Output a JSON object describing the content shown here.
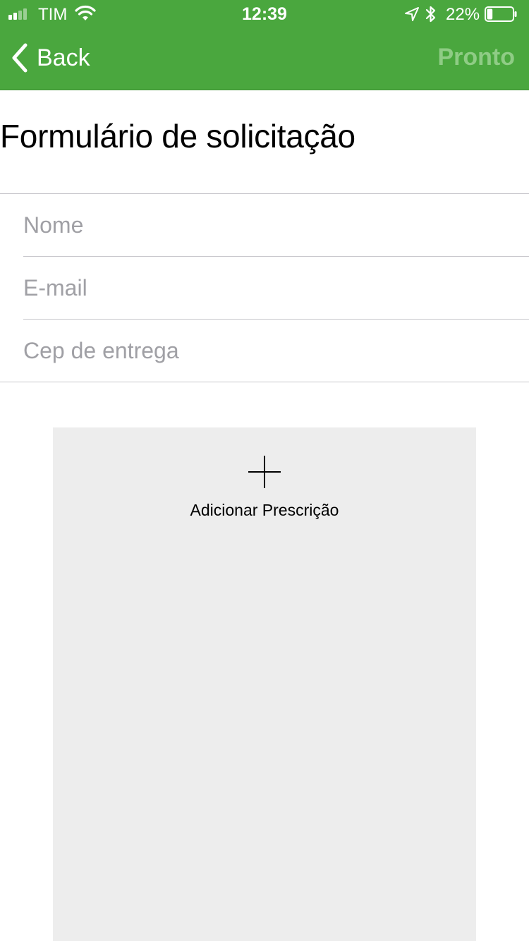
{
  "status_bar": {
    "carrier": "TIM",
    "time": "12:39",
    "battery_percent": "22%",
    "battery_level": 0.22,
    "icons": [
      "signal-icon",
      "wifi-icon",
      "location-arrow-icon",
      "bluetooth-icon",
      "battery-icon"
    ]
  },
  "nav": {
    "back_label": "Back",
    "done_label": "Pronto"
  },
  "page": {
    "title": "Formulário de solicitação"
  },
  "form": {
    "name": {
      "placeholder": "Nome",
      "value": ""
    },
    "email": {
      "placeholder": "E-mail",
      "value": ""
    },
    "zip": {
      "placeholder": "Cep de entrega",
      "value": ""
    }
  },
  "prescription": {
    "add_label": "Adicionar Prescrição",
    "icon": "plus-icon"
  },
  "colors": {
    "nav_background": "#4aa73e",
    "done_disabled": "#8fcc85",
    "placeholder": "#a0a0a5",
    "separator": "#c8c7cc",
    "box_background": "#ededed"
  }
}
